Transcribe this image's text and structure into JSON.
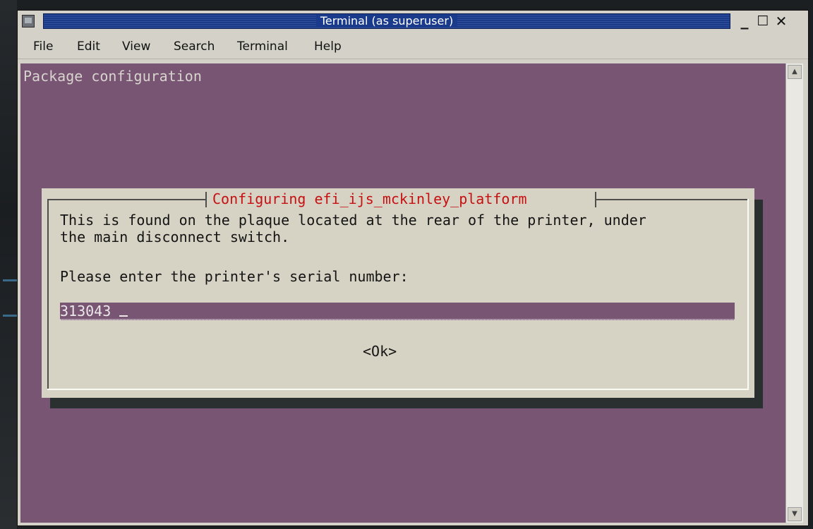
{
  "window": {
    "title": "Terminal (as superuser)",
    "controls": {
      "minimize": "_",
      "maximize": "☐",
      "close": "✕"
    }
  },
  "menu": {
    "items": [
      "File",
      "Edit",
      "View",
      "Search",
      "Terminal",
      "Help"
    ]
  },
  "terminal": {
    "header": "Package configuration",
    "background": "#775573"
  },
  "dialog": {
    "title": "Configuring efi_ijs_mckinley_platform",
    "description_line1": "This is found on the plaque located at the rear of the printer, under",
    "description_line2": "the main disconnect switch.",
    "prompt": "Please enter the printer's serial number:",
    "input_value": "313043",
    "ok_label": "<Ok>",
    "title_color": "#c61012"
  },
  "icons": {
    "window_icon": "terminal-window-icon",
    "scroll_up": "scroll-up-arrow-icon",
    "scroll_down": "scroll-down-arrow-icon"
  }
}
